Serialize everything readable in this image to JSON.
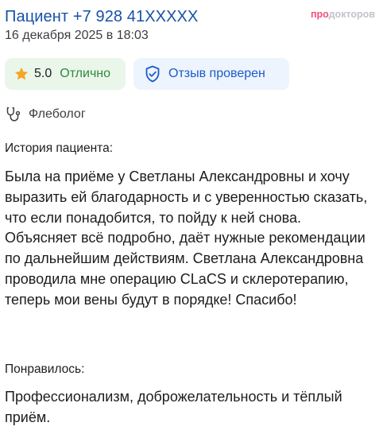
{
  "header": {
    "patient_name": "Пациент +7 928 41XXXXX",
    "date": "16 декабря 2025 в 18:03",
    "brand_part1": "про",
    "brand_part2": "докторов"
  },
  "badges": {
    "rating": {
      "icon": "star-icon",
      "value": "5.0",
      "label": "Отлично",
      "color": "#2e8b3d",
      "background": "#eaf6ea"
    },
    "verified": {
      "icon": "shield-check-icon",
      "label": "Отзыв проверен",
      "color": "#1b5cc8",
      "background": "#eef4fd"
    }
  },
  "specialty": {
    "icon": "stethoscope-icon",
    "label": "Флеболог"
  },
  "story": {
    "title": "История пациента:",
    "text": "Была на приёме у Светланы Александровны и хочу выразить ей благодарность и с уверенностью сказать, что если понадобится, то пойду к ней снова. Объясняет всё подробно, даёт нужные рекомендации по дальнейшим действиям. Светлана Александровна проводила мне операцию CLaCS и склеротерапию, теперь мои вены будут в порядке! Спасибо!"
  },
  "liked": {
    "title": "Понравилось:",
    "text": "Профессионализм, доброжелательность и тёплый приём."
  },
  "colors": {
    "link_blue": "#1652a7",
    "brand_pink": "#f0507a",
    "brand_gray": "#c0c4ca",
    "star_orange": "#f5a623"
  }
}
